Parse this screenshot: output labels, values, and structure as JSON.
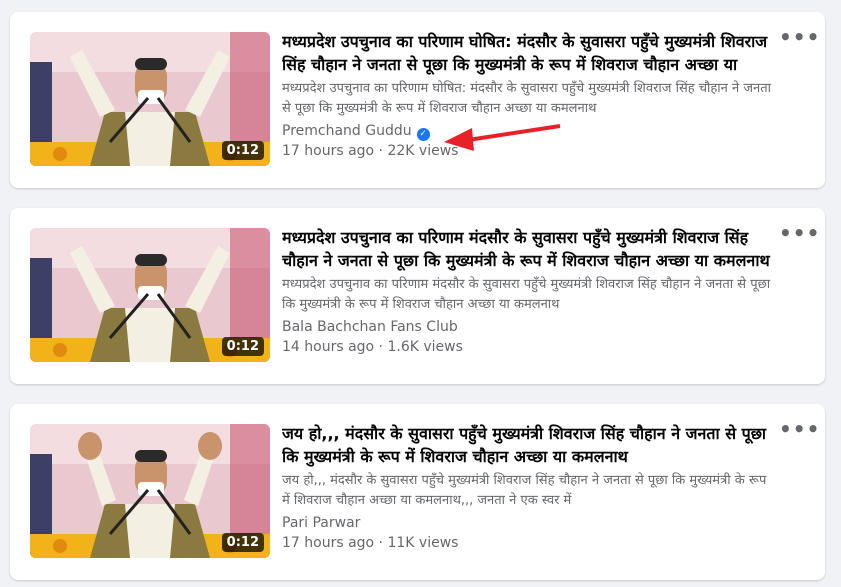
{
  "videos": [
    {
      "title": "मध्यप्रदेश उपचुनाव का परिणाम घोषित: मंदसौर के सुवासरा पहुँचे मुख्यमंत्री शिवराज सिंह चौहान ने जनता से पूछा कि मुख्यमंत्री के रूप में शिवराज चौहान अच्छा या कमलनाथ",
      "description": "मध्यप्रदेश उपचुनाव का परिणाम घोषित: मंदसौर के सुवासरा पहुँचे मुख्यमंत्री शिवराज सिंह चौहान ने जनता से पूछा कि मुख्यमंत्री के रूप में शिवराज चौहान अच्छा या कमलनाथ",
      "author": "Premchand Guddu",
      "verified": true,
      "age": "17 hours ago",
      "views": "22K views",
      "duration": "0:12"
    },
    {
      "title": "मध्यप्रदेश उपचुनाव का परिणाम मंदसौर के सुवासरा पहुँचे मुख्यमंत्री शिवराज सिंह चौहान ने जनता से पूछा कि मुख्यमंत्री के रूप में शिवराज चौहान अच्छा या कमलनाथ",
      "description": "मध्यप्रदेश उपचुनाव का परिणाम मंदसौर के सुवासरा पहुँचे मुख्यमंत्री शिवराज सिंह चौहान ने जनता से पूछा कि मुख्यमंत्री के रूप में शिवराज चौहान अच्छा या कमलनाथ",
      "author": "Bala Bachchan Fans Club",
      "verified": false,
      "age": "14 hours ago",
      "views": "1.6K views",
      "duration": "0:12"
    },
    {
      "title": "जय हो,,, मंदसौर के सुवासरा पहुँचे मुख्यमंत्री शिवराज सिंह चौहान ने जनता से पूछा कि मुख्यमंत्री के रूप में शिवराज चौहान अच्छा या कमलनाथ",
      "description": "जय हो,,, मंदसौर के सुवासरा पहुँचे मुख्यमंत्री शिवराज सिंह चौहान ने जनता से पूछा कि मुख्यमंत्री के रूप में शिवराज चौहान अच्छा या कमलनाथ,,, जनता ने एक स्वर में",
      "author": "Pari Parwar",
      "verified": false,
      "age": "17 hours ago",
      "views": "11K views",
      "duration": "0:12"
    }
  ],
  "meta_separator": " · ",
  "more_icon": "more-options-icon",
  "annotation": {
    "arrow_color": "#e8202a",
    "points_to": "verified-badge"
  },
  "colors": {
    "verified": "#1877f2",
    "secondary_text": "#65676b",
    "primary_text": "#050505"
  }
}
